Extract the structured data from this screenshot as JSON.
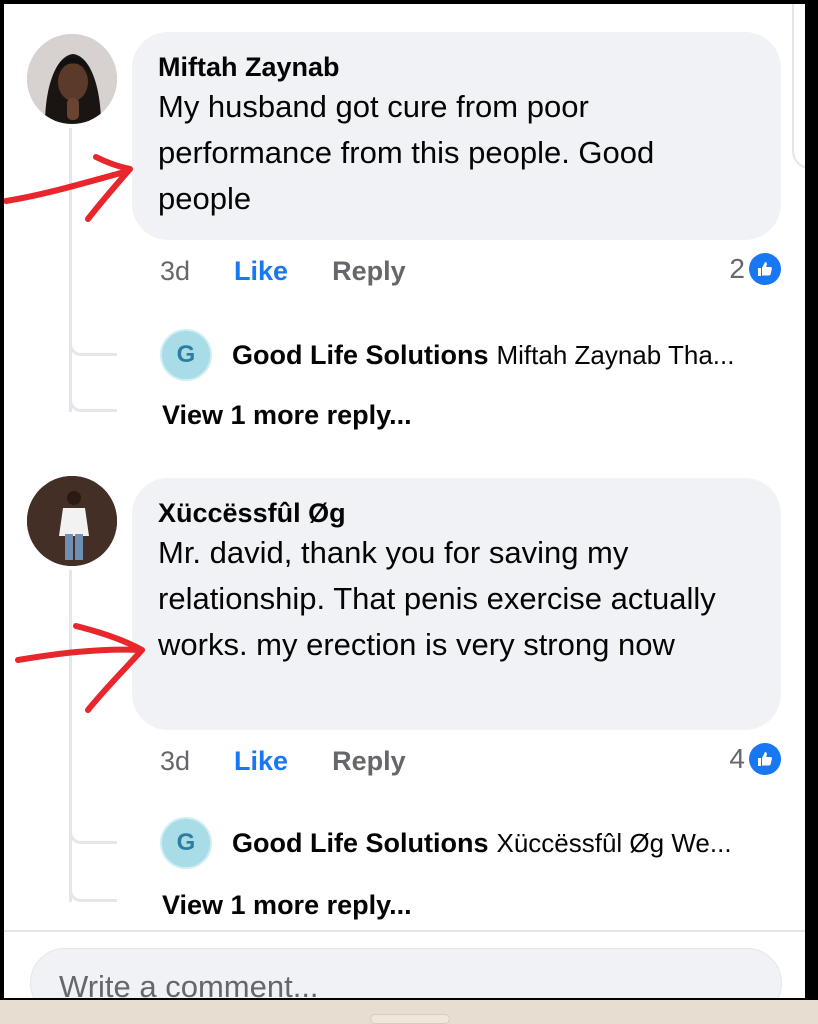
{
  "comments": [
    {
      "author": "Miftah Zaynab",
      "text": "My husband got cure from poor performance from this people. Good people",
      "time": "3d",
      "like_label": "Like",
      "reply_label": "Reply",
      "reaction_count": "2",
      "reply_preview": {
        "page_initial": "G",
        "page_name": "Good Life Solutions",
        "snippet": "Miftah Zaynab Tha..."
      },
      "more_replies": "View 1 more reply..."
    },
    {
      "author": "Xüccëssfûl Øg",
      "text": "Mr. david, thank you for saving my relationship. That penis exercise actually works. my erection is very strong now",
      "time": "3d",
      "like_label": "Like",
      "reply_label": "Reply",
      "reaction_count": "4",
      "reply_preview": {
        "page_initial": "G",
        "page_name": "Good Life Solutions",
        "snippet": "Xüccëssfûl Øg We..."
      },
      "more_replies": "View 1 more reply..."
    }
  ],
  "composer": {
    "placeholder": "Write a comment..."
  },
  "colors": {
    "accent": "#1877f2",
    "bubble": "#f0f2f5",
    "annotation": "#e8262c"
  },
  "icons": [
    "like-reaction-icon",
    "red-arrow-annotation"
  ]
}
